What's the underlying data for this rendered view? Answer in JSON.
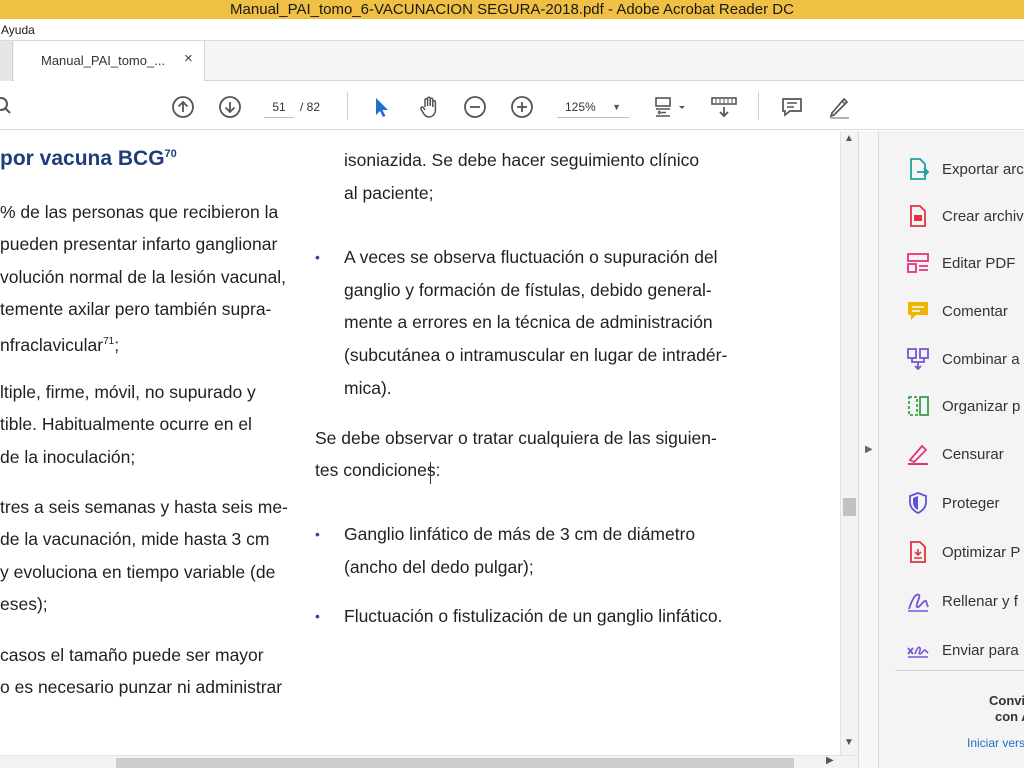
{
  "window": {
    "title": "Manual_PAI_tomo_6-VACUNACION SEGURA-2018.pdf - Adobe Acrobat Reader DC"
  },
  "menu": {
    "items": [
      "Ayuda"
    ]
  },
  "tabs": [
    {
      "label": "Manual_PAI_tomo_...",
      "close": "×"
    }
  ],
  "toolbar": {
    "current_page": "51",
    "total_pages": "/ 82",
    "zoom": "125%",
    "zoom_caret": "▼",
    "icons": [
      "search-icon",
      "page-up-icon",
      "page-down-icon",
      "select-cursor-icon",
      "hand-tool-icon",
      "zoom-out-icon",
      "zoom-in-icon",
      "fit-page-icon",
      "scroll-mode-icon",
      "comment-icon",
      "sign-icon"
    ]
  },
  "document": {
    "heading": "por vacuna BCG",
    "heading_ref": "70",
    "left_column": [
      "% de las personas que recibieron la",
      "pueden presentar infarto ganglionar",
      "volución normal de la lesión vacunal,",
      "temente axilar pero también supra-",
      "nfraclavicular",
      "ltiple, firme, móvil, no supurado y",
      "tible. Habitualmente ocurre en el",
      "de la inoculación;",
      "tres a seis semanas y hasta seis me-",
      "de la vacunación, mide hasta 3 cm",
      "y evoluciona en tiempo variable (de",
      "eses);",
      "casos el tamaño puede ser mayor",
      "o es necesario punzar ni administrar"
    ],
    "left_ref_71": "71",
    "left_ref_suffix": ";",
    "right_column": {
      "continuation": [
        "isoniazida. Se debe hacer seguimiento clínico",
        "al paciente;"
      ],
      "bullet1": [
        "A veces se observa fluctuación o supuración del",
        "ganglio y formación de fístulas, debido general-",
        "mente a errores en la técnica de administración",
        "(subcutánea o intramuscular en lugar de intradér-",
        "mica)."
      ],
      "paragraph": [
        "Se debe observar o tratar cualquiera de las siguien-",
        "tes condiciones:"
      ],
      "bullet2": [
        "Ganglio linfático de más de 3 cm de diámetro",
        "(ancho del dedo pulgar);"
      ],
      "bullet3": [
        "Fluctuación o fistulización de un ganglio linfático."
      ]
    },
    "bullet_char": "•"
  },
  "right_pane": {
    "tools": [
      {
        "label": "Exportar arc",
        "icon": "export-pdf-icon",
        "color": "#1aa3a3"
      },
      {
        "label": "Crear archiv",
        "icon": "create-pdf-icon",
        "color": "#e0353f"
      },
      {
        "label": "Editar PDF",
        "icon": "edit-pdf-icon",
        "color": "#e0357f"
      },
      {
        "label": "Comentar",
        "icon": "comment-tool-icon",
        "color": "#f0b400"
      },
      {
        "label": "Combinar a",
        "icon": "combine-files-icon",
        "color": "#7b54d6"
      },
      {
        "label": "Organizar p",
        "icon": "organize-pages-icon",
        "color": "#3aa04a"
      },
      {
        "label": "Censurar",
        "icon": "redact-icon",
        "color": "#e0357f"
      },
      {
        "label": "Proteger",
        "icon": "protect-icon",
        "color": "#5a54d6"
      },
      {
        "label": "Optimizar P",
        "icon": "optimize-pdf-icon",
        "color": "#e0353f"
      },
      {
        "label": "Rellenar y f",
        "icon": "fill-sign-icon",
        "color": "#7b54d6"
      },
      {
        "label": "Enviar para",
        "icon": "send-for-signature-icon",
        "color": "#7b54d6"
      }
    ],
    "promo_line1": "Convi",
    "promo_line2": "con A",
    "promo_link": "Iniciar vers"
  },
  "scroll": {
    "up": "▲",
    "down": "▼",
    "right": "▶",
    "collapse": "▶"
  }
}
